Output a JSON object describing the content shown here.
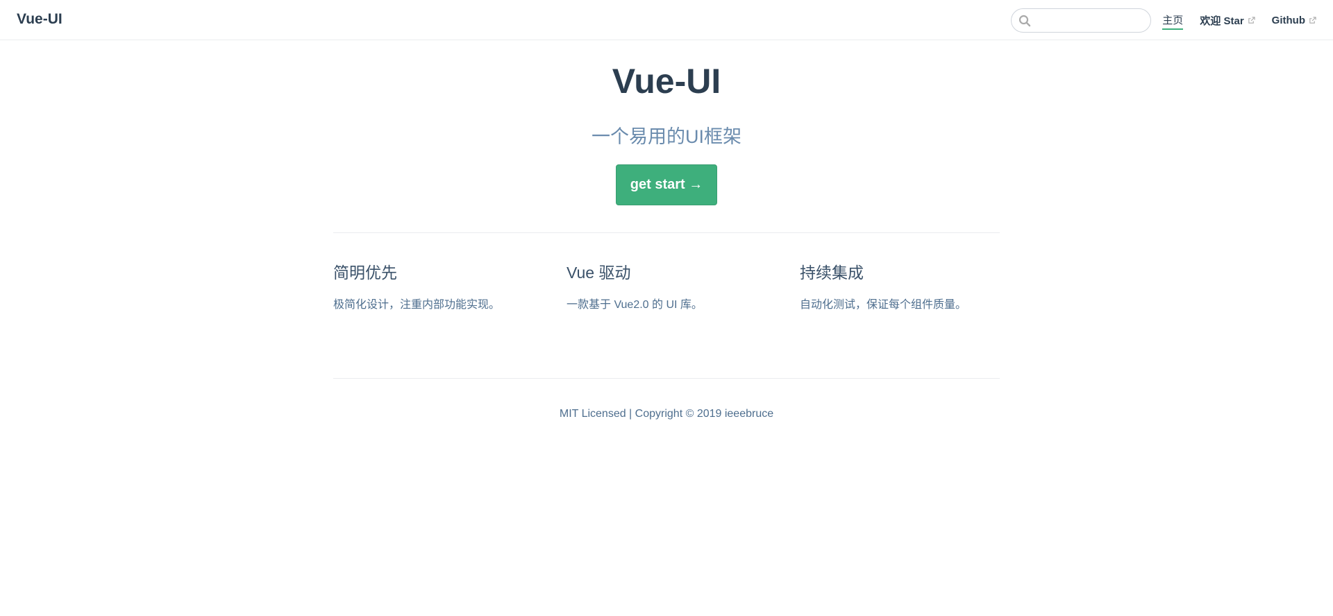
{
  "navbar": {
    "site_name": "Vue-UI",
    "search": {
      "value": "",
      "placeholder": ""
    },
    "links": [
      {
        "label": "主页",
        "active": true,
        "external": false
      },
      {
        "label": "欢迎 Star",
        "active": false,
        "external": true
      },
      {
        "label": "Github",
        "active": false,
        "external": true
      }
    ]
  },
  "hero": {
    "title": "Vue-UI",
    "description": "一个易用的UI框架",
    "action_label": "get start →"
  },
  "features": [
    {
      "title": "简明优先",
      "details": "极简化设计，注重内部功能实现。"
    },
    {
      "title": "Vue 驱动",
      "details": "一款基于 Vue2.0 的 UI 库。"
    },
    {
      "title": "持续集成",
      "details": "自动化测试，保证每个组件质量。"
    }
  ],
  "footer": {
    "text": "MIT Licensed | Copyright © 2019 ieeebruce"
  },
  "colors": {
    "accent": "#3eaf7c",
    "text": "#2c3e50",
    "muted": "#6a8bad",
    "border": "#eaecef"
  },
  "icons": {
    "search": "search-icon",
    "external": "external-link-icon"
  }
}
